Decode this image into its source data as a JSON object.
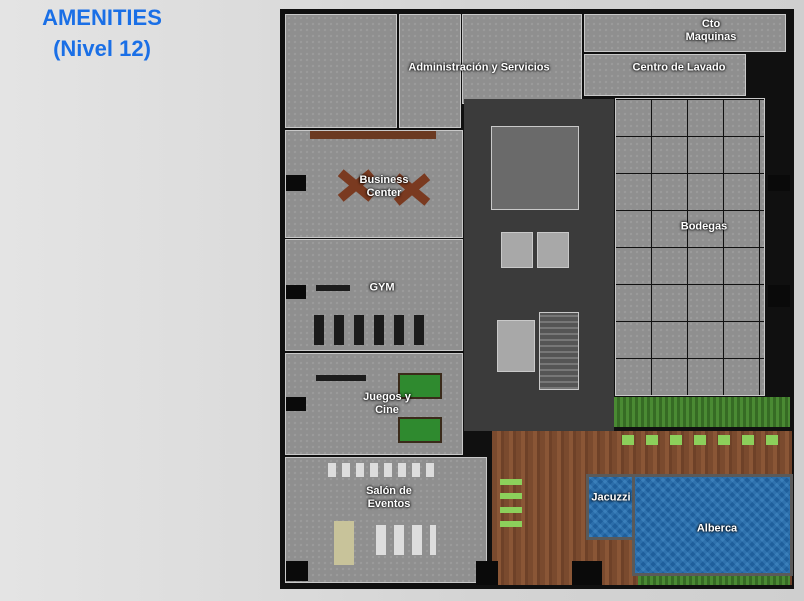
{
  "header": {
    "title_line1": "AMENITIES",
    "title_line2": "(Nivel 12)"
  },
  "colors": {
    "title": "#1a6fe6",
    "floor": "#8f8f8f",
    "core": "#3b3b3b",
    "deck": "#7a4a2e",
    "pool": "#1f5f9c",
    "grass": "#3f7a2a"
  },
  "plan": {
    "labels": {
      "cto_maquinas": "Cto\nMaquinas",
      "administracion": "Administración  y Servicios",
      "centro_lavado": "Centro de Lavado",
      "business_center": "Business\nCenter",
      "bodegas": "Bodegas",
      "gym": "GYM",
      "juegos_cine": "Juegos y\nCine",
      "salon_eventos": "Salón de\nEventos",
      "jacuzzi": "Jacuzzi",
      "alberca": "Alberca"
    }
  }
}
